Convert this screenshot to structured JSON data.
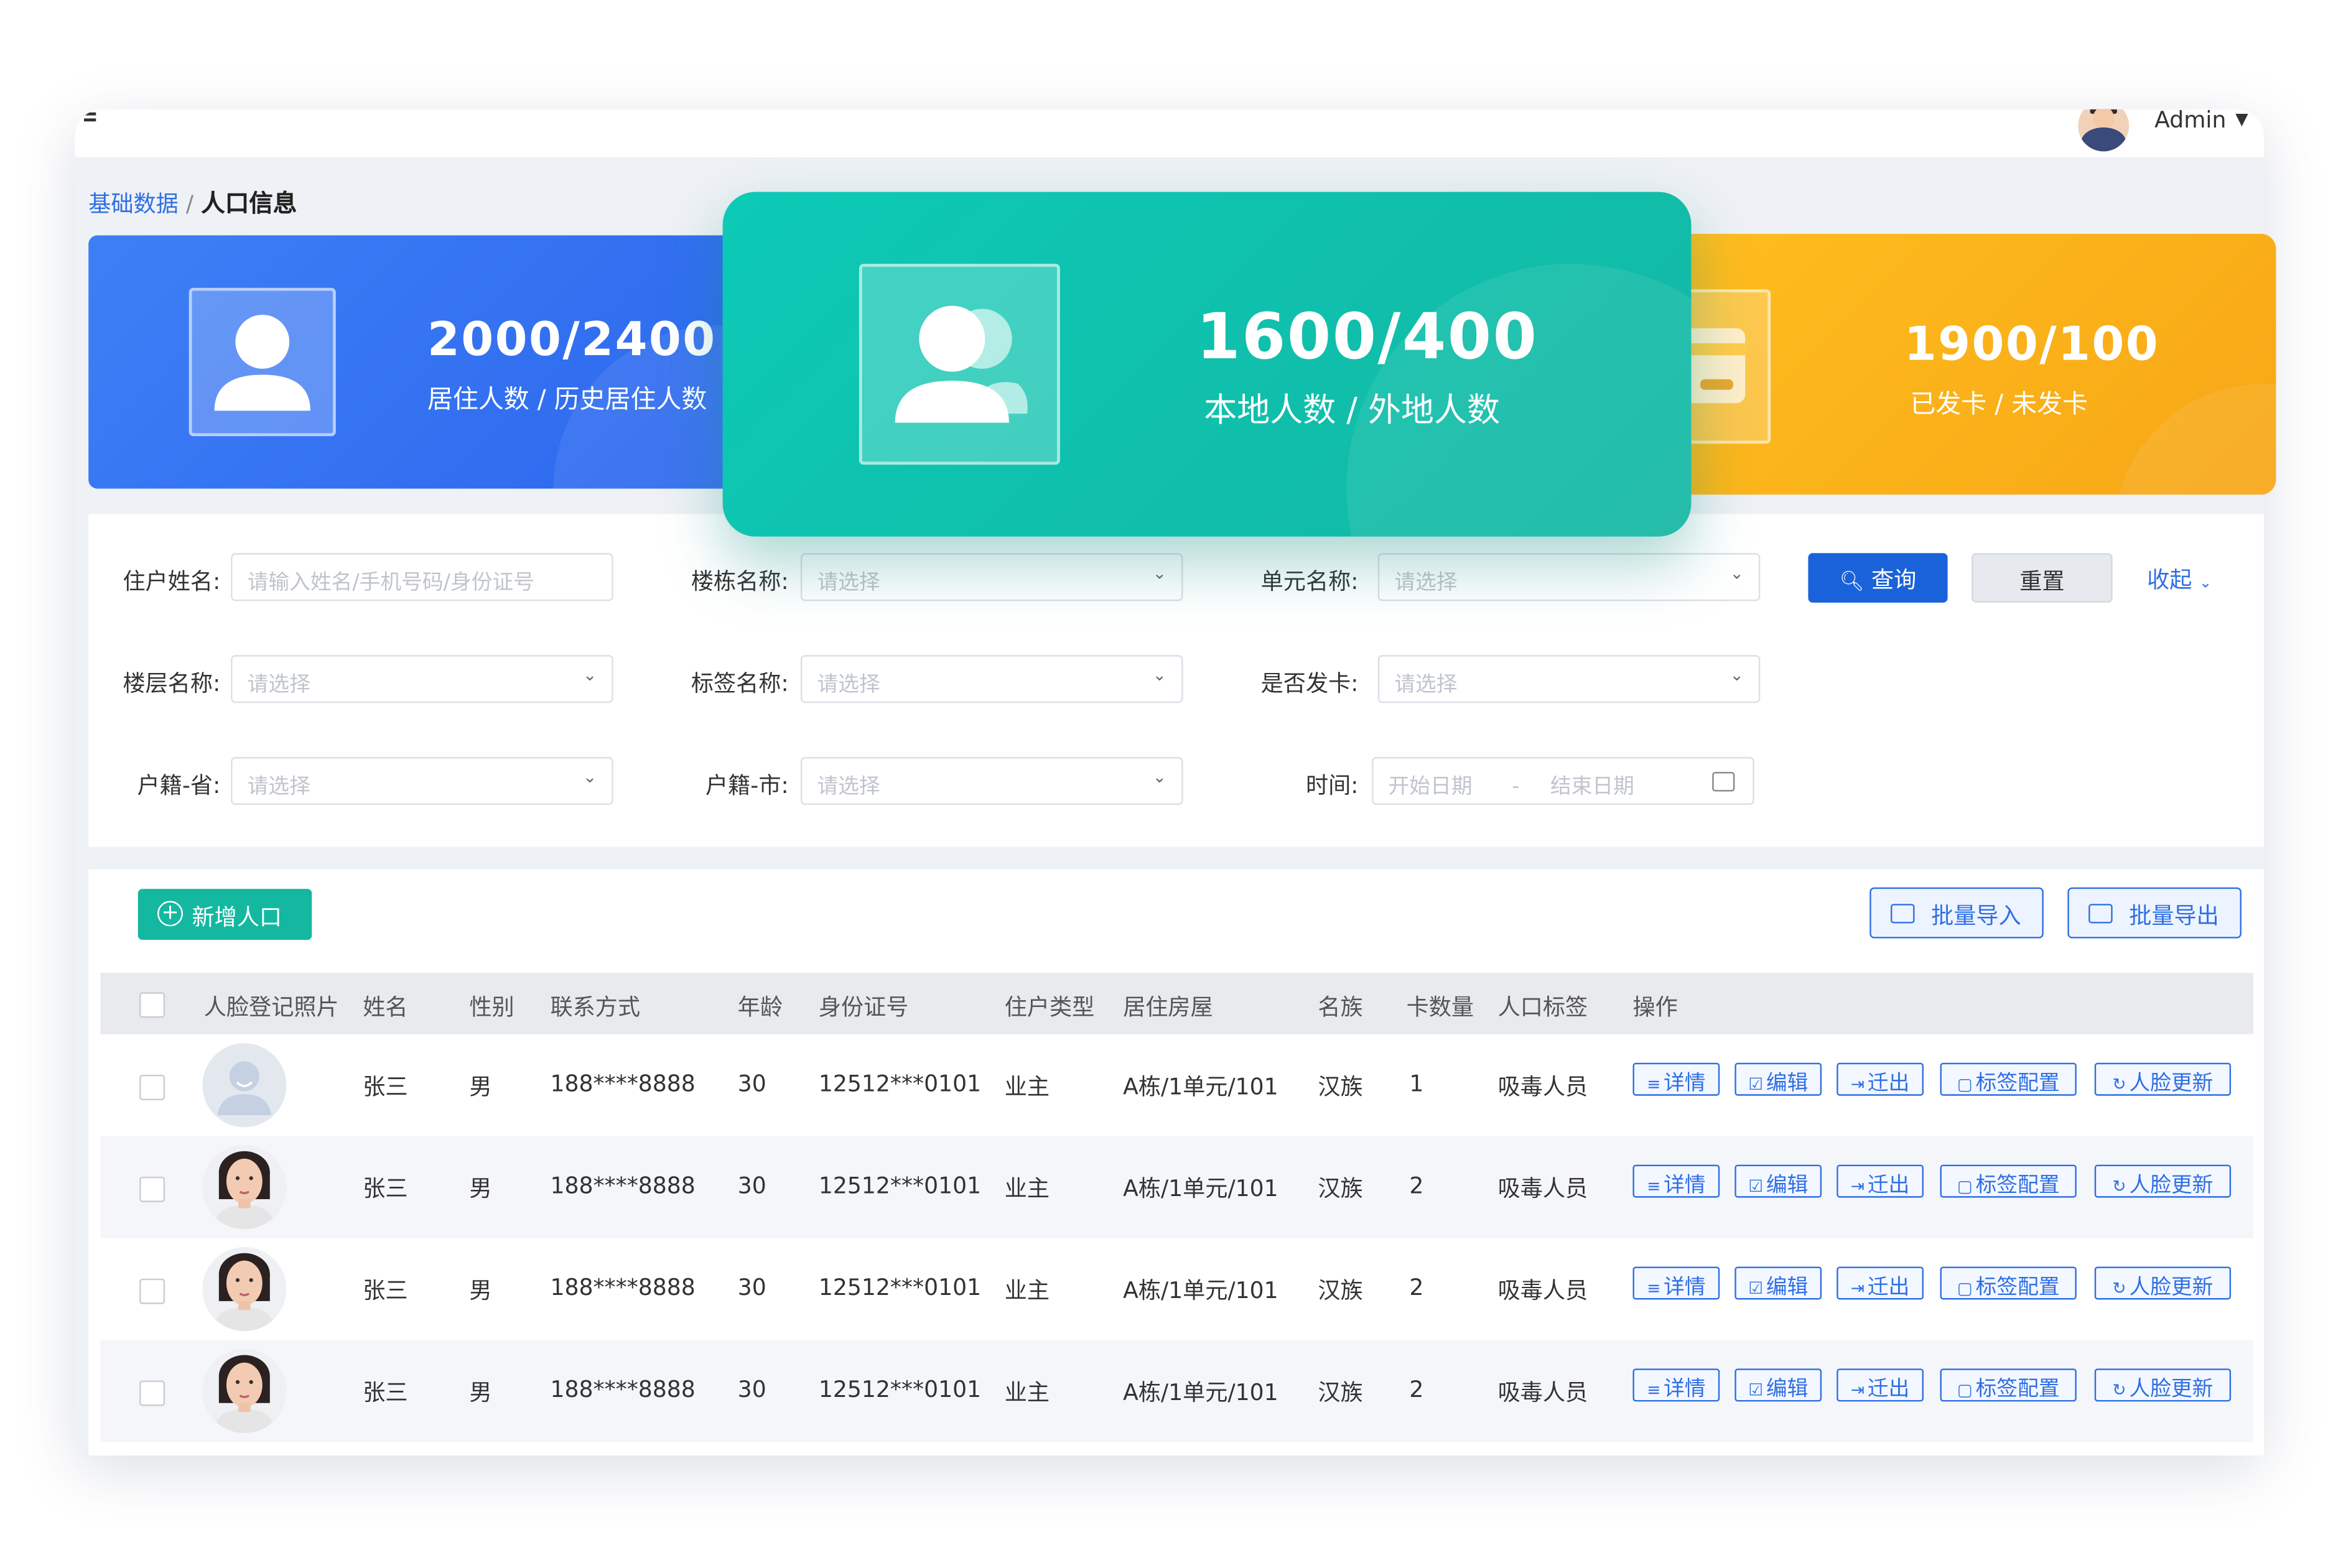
{
  "header": {
    "user_name": "Admin",
    "caret": "⌄"
  },
  "breadcrumb": {
    "parent": "基础数据",
    "separator": "/",
    "current": "人口信息"
  },
  "stats": {
    "residents": {
      "value": "2000/2400",
      "label": "居住人数 / 历史居住人数",
      "color": "#2f6fed"
    },
    "local": {
      "value": "1600/400",
      "label": "本地人数 / 外地人数",
      "color": "#10c2ae"
    },
    "cards": {
      "value": "1900/100",
      "label": "已发卡 / 未发卡",
      "color": "#fbb21c"
    }
  },
  "filters": {
    "name": {
      "label": "住户姓名:",
      "placeholder": "请输入姓名/手机号码/身份证号"
    },
    "building": {
      "label": "楼栋名称:",
      "placeholder": "请选择"
    },
    "unit": {
      "label": "单元名称:",
      "placeholder": "请选择"
    },
    "floor": {
      "label": "楼层名称:",
      "placeholder": "请选择"
    },
    "tag": {
      "label": "标签名称:",
      "placeholder": "请选择"
    },
    "card_issued": {
      "label": "是否发卡:",
      "placeholder": "请选择"
    },
    "province": {
      "label": "户籍-省:",
      "placeholder": "请选择"
    },
    "city": {
      "label": "户籍-市:",
      "placeholder": "请选择"
    },
    "time": {
      "label": "时间:",
      "start_placeholder": "开始日期",
      "range_separator": "-",
      "end_placeholder": "结束日期"
    },
    "query_button": "查询",
    "reset_button": "重置",
    "collapse_link": "收起"
  },
  "toolbar": {
    "add_button": "新增人口",
    "import_button": "批量导入",
    "export_button": "批量导出"
  },
  "table": {
    "columns": [
      "人脸登记照片",
      "姓名",
      "性别",
      "联系方式",
      "年龄",
      "身份证号",
      "住户类型",
      "居住房屋",
      "名族",
      "卡数量",
      "人口标签",
      "操作"
    ],
    "actions": [
      "详情",
      "编辑",
      "迁出",
      "标签配置",
      "人脸更新"
    ],
    "rows": [
      {
        "name": "张三",
        "gender": "男",
        "phone": "188****8888",
        "age": "30",
        "id_number": "12512***0101",
        "type": "业主",
        "house": "A栋/1单元/101",
        "ethnicity": "汉族",
        "cards": "1",
        "tag": "吸毒人员",
        "photo": "default-avatar"
      },
      {
        "name": "张三",
        "gender": "男",
        "phone": "188****8888",
        "age": "30",
        "id_number": "12512***0101",
        "type": "业主",
        "house": "A栋/1单元/101",
        "ethnicity": "汉族",
        "cards": "2",
        "tag": "吸毒人员",
        "photo": "face-photo"
      },
      {
        "name": "张三",
        "gender": "男",
        "phone": "188****8888",
        "age": "30",
        "id_number": "12512***0101",
        "type": "业主",
        "house": "A栋/1单元/101",
        "ethnicity": "汉族",
        "cards": "2",
        "tag": "吸毒人员",
        "photo": "face-photo"
      },
      {
        "name": "张三",
        "gender": "男",
        "phone": "188****8888",
        "age": "30",
        "id_number": "12512***0101",
        "type": "业主",
        "house": "A栋/1单元/101",
        "ethnicity": "汉族",
        "cards": "2",
        "tag": "吸毒人员",
        "photo": "face-photo"
      }
    ]
  },
  "theme": {
    "primary": "#2f6fe4",
    "teal": "#14b8a0"
  }
}
